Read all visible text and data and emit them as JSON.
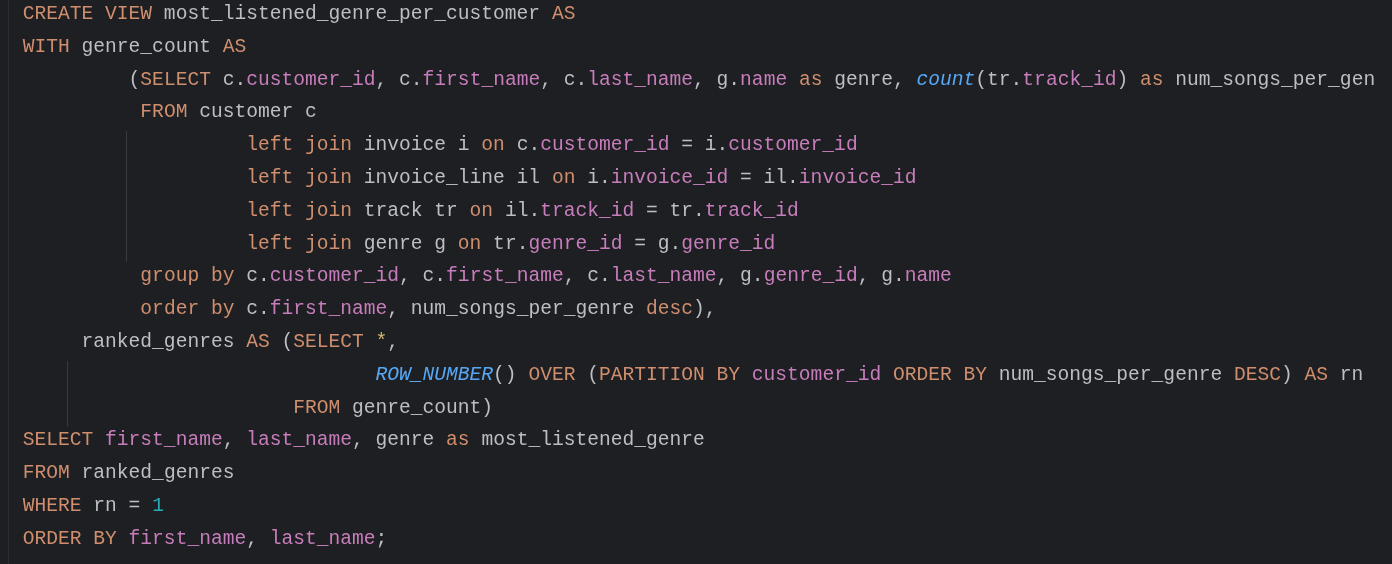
{
  "editor": {
    "lines": [
      {
        "guide": false,
        "tokens": [
          {
            "kind": "kw",
            "text": "CREATE VIEW"
          },
          {
            "kind": "plain",
            "text": " most_listened_genre_per_customer "
          },
          {
            "kind": "kw",
            "text": "AS"
          }
        ]
      },
      {
        "guide": false,
        "tokens": [
          {
            "kind": "kw",
            "text": "WITH"
          },
          {
            "kind": "plain",
            "text": " genre_count "
          },
          {
            "kind": "kw",
            "text": "AS"
          }
        ]
      },
      {
        "guide": false,
        "tokens": [
          {
            "kind": "plain",
            "text": "         ("
          },
          {
            "kind": "kw",
            "text": "SELECT"
          },
          {
            "kind": "plain",
            "text": " c."
          },
          {
            "kind": "field",
            "text": "customer_id"
          },
          {
            "kind": "plain",
            "text": ", c."
          },
          {
            "kind": "field",
            "text": "first_name"
          },
          {
            "kind": "plain",
            "text": ", c."
          },
          {
            "kind": "field",
            "text": "last_name"
          },
          {
            "kind": "plain",
            "text": ", g."
          },
          {
            "kind": "field",
            "text": "name"
          },
          {
            "kind": "kw",
            "text": " as"
          },
          {
            "kind": "plain",
            "text": " genre, "
          },
          {
            "kind": "fn",
            "text": "count"
          },
          {
            "kind": "plain",
            "text": "(tr."
          },
          {
            "kind": "field",
            "text": "track_id"
          },
          {
            "kind": "plain",
            "text": ") "
          },
          {
            "kind": "kw",
            "text": "as"
          },
          {
            "kind": "plain",
            "text": " num_songs_per_gen"
          }
        ]
      },
      {
        "guide": false,
        "tokens": [
          {
            "kind": "kw",
            "text": "          FROM"
          },
          {
            "kind": "plain",
            "text": " customer c"
          }
        ]
      },
      {
        "guide": true,
        "tokens": [
          {
            "kind": "kw",
            "text": "                   left join"
          },
          {
            "kind": "plain",
            "text": " invoice i "
          },
          {
            "kind": "kw",
            "text": "on"
          },
          {
            "kind": "plain",
            "text": " c."
          },
          {
            "kind": "field",
            "text": "customer_id"
          },
          {
            "kind": "plain",
            "text": " = i."
          },
          {
            "kind": "field",
            "text": "customer_id"
          }
        ]
      },
      {
        "guide": true,
        "tokens": [
          {
            "kind": "kw",
            "text": "                   left join"
          },
          {
            "kind": "plain",
            "text": " invoice_line il "
          },
          {
            "kind": "kw",
            "text": "on"
          },
          {
            "kind": "plain",
            "text": " i."
          },
          {
            "kind": "field",
            "text": "invoice_id"
          },
          {
            "kind": "plain",
            "text": " = il."
          },
          {
            "kind": "field",
            "text": "invoice_id"
          }
        ]
      },
      {
        "guide": true,
        "tokens": [
          {
            "kind": "kw",
            "text": "                   left join"
          },
          {
            "kind": "plain",
            "text": " track tr "
          },
          {
            "kind": "kw",
            "text": "on"
          },
          {
            "kind": "plain",
            "text": " il."
          },
          {
            "kind": "field",
            "text": "track_id"
          },
          {
            "kind": "plain",
            "text": " = tr."
          },
          {
            "kind": "field",
            "text": "track_id"
          }
        ]
      },
      {
        "guide": true,
        "tokens": [
          {
            "kind": "kw",
            "text": "                   left join"
          },
          {
            "kind": "plain",
            "text": " genre g "
          },
          {
            "kind": "kw",
            "text": "on"
          },
          {
            "kind": "plain",
            "text": " tr."
          },
          {
            "kind": "field",
            "text": "genre_id"
          },
          {
            "kind": "plain",
            "text": " = g."
          },
          {
            "kind": "field",
            "text": "genre_id"
          }
        ]
      },
      {
        "guide": false,
        "tokens": [
          {
            "kind": "kw",
            "text": "          group by"
          },
          {
            "kind": "plain",
            "text": " c."
          },
          {
            "kind": "field",
            "text": "customer_id"
          },
          {
            "kind": "plain",
            "text": ", c."
          },
          {
            "kind": "field",
            "text": "first_name"
          },
          {
            "kind": "plain",
            "text": ", c."
          },
          {
            "kind": "field",
            "text": "last_name"
          },
          {
            "kind": "plain",
            "text": ", g."
          },
          {
            "kind": "field",
            "text": "genre_id"
          },
          {
            "kind": "plain",
            "text": ", g."
          },
          {
            "kind": "field",
            "text": "name"
          }
        ]
      },
      {
        "guide": false,
        "tokens": [
          {
            "kind": "kw",
            "text": "          order by"
          },
          {
            "kind": "plain",
            "text": " c."
          },
          {
            "kind": "field",
            "text": "first_name"
          },
          {
            "kind": "plain",
            "text": ", num_songs_per_genre "
          },
          {
            "kind": "kw",
            "text": "desc"
          },
          {
            "kind": "plain",
            "text": "),"
          }
        ]
      },
      {
        "guide": false,
        "tokens": [
          {
            "kind": "plain",
            "text": "     ranked_genres "
          },
          {
            "kind": "kw",
            "text": "AS"
          },
          {
            "kind": "plain",
            "text": " ("
          },
          {
            "kind": "kw",
            "text": "SELECT "
          },
          {
            "kind": "star",
            "text": "*"
          },
          {
            "kind": "plain",
            "text": ","
          }
        ]
      },
      {
        "guide": true,
        "tokens": [
          {
            "kind": "fn",
            "text": "                              ROW_NUMBER"
          },
          {
            "kind": "plain",
            "text": "() "
          },
          {
            "kind": "kw",
            "text": "OVER"
          },
          {
            "kind": "plain",
            "text": " ("
          },
          {
            "kind": "kw",
            "text": "PARTITION BY "
          },
          {
            "kind": "field",
            "text": "customer_id"
          },
          {
            "kind": "kw",
            "text": " ORDER BY"
          },
          {
            "kind": "plain",
            "text": " num_songs_per_genre "
          },
          {
            "kind": "kw",
            "text": "DESC"
          },
          {
            "kind": "plain",
            "text": ") "
          },
          {
            "kind": "kw",
            "text": "AS"
          },
          {
            "kind": "plain",
            "text": " rn"
          }
        ]
      },
      {
        "guide": true,
        "tokens": [
          {
            "kind": "kw",
            "text": "                       FROM"
          },
          {
            "kind": "plain",
            "text": " genre_count)"
          }
        ]
      },
      {
        "guide": false,
        "tokens": [
          {
            "kind": "kw",
            "text": "SELECT "
          },
          {
            "kind": "field",
            "text": "first_name"
          },
          {
            "kind": "plain",
            "text": ", "
          },
          {
            "kind": "field",
            "text": "last_name"
          },
          {
            "kind": "plain",
            "text": ", genre "
          },
          {
            "kind": "kw",
            "text": "as"
          },
          {
            "kind": "plain",
            "text": " most_listened_genre"
          }
        ]
      },
      {
        "guide": false,
        "tokens": [
          {
            "kind": "kw",
            "text": "FROM"
          },
          {
            "kind": "plain",
            "text": " ranked_genres"
          }
        ]
      },
      {
        "guide": false,
        "tokens": [
          {
            "kind": "kw",
            "text": "WHERE"
          },
          {
            "kind": "plain",
            "text": " rn = "
          },
          {
            "kind": "num",
            "text": "1"
          }
        ]
      },
      {
        "guide": false,
        "tokens": [
          {
            "kind": "kw",
            "text": "ORDER BY "
          },
          {
            "kind": "field",
            "text": "first_name"
          },
          {
            "kind": "plain",
            "text": ", "
          },
          {
            "kind": "field",
            "text": "last_name"
          },
          {
            "kind": "plain",
            "text": ";"
          }
        ]
      }
    ]
  }
}
